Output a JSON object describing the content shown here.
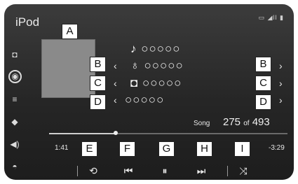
{
  "app": {
    "title": "iPod",
    "status_icons": "▭ ◢ll ▮"
  },
  "labels": {
    "A": "A",
    "B": "B",
    "C": "C",
    "D": "D",
    "E": "E",
    "F": "F",
    "G": "G",
    "H": "H",
    "I": "I"
  },
  "rows": [
    {
      "icon": "♪",
      "text": "○○○○○"
    },
    {
      "icon": "♁",
      "text": "○○○○○"
    },
    {
      "icon": "◘",
      "text": "○○○○○"
    },
    {
      "icon": "",
      "text": "○○○○○"
    }
  ],
  "arrows": {
    "left": "‹",
    "right": "›"
  },
  "song": {
    "label": "Song",
    "current": "275",
    "of": "of",
    "total": "493"
  },
  "progress": {
    "fraction": 0.28,
    "elapsed": "1:41",
    "remaining": "-3:29"
  },
  "controls": {
    "repeat": "⟲",
    "prev": "⏮",
    "pause": "⏸",
    "next": "⏭",
    "shuffle": "⤨"
  },
  "sidebar": {
    "items": [
      "◘",
      "◉",
      "≡",
      "◆",
      "◀)",
      "◓"
    ]
  }
}
